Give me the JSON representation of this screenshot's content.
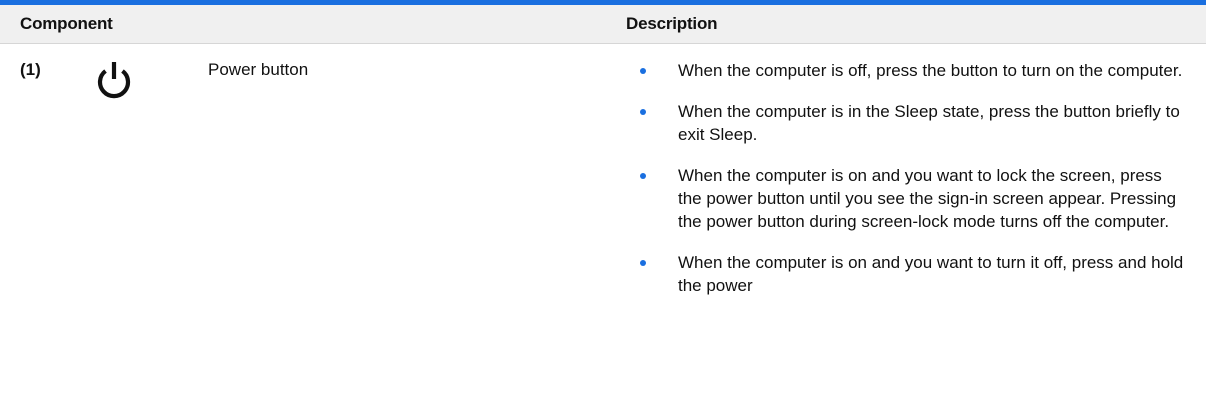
{
  "table": {
    "headers": {
      "component": "Component",
      "description": "Description"
    },
    "rows": [
      {
        "number": "(1)",
        "icon": "power-icon",
        "name": "Power button",
        "descriptions": [
          "When the computer is off, press the button to turn on the computer.",
          "When the computer is in the Sleep state, press the button briefly to exit Sleep.",
          "When the computer is on and you want to lock the screen, press the power button until you see the sign-in screen appear. Pressing the power button during screen-lock mode turns off the computer.",
          "When the computer is on and you want to turn it off, press and hold the power"
        ]
      }
    ]
  },
  "colors": {
    "accent": "#1a6fe0",
    "header_bg": "#f0f0f0"
  }
}
